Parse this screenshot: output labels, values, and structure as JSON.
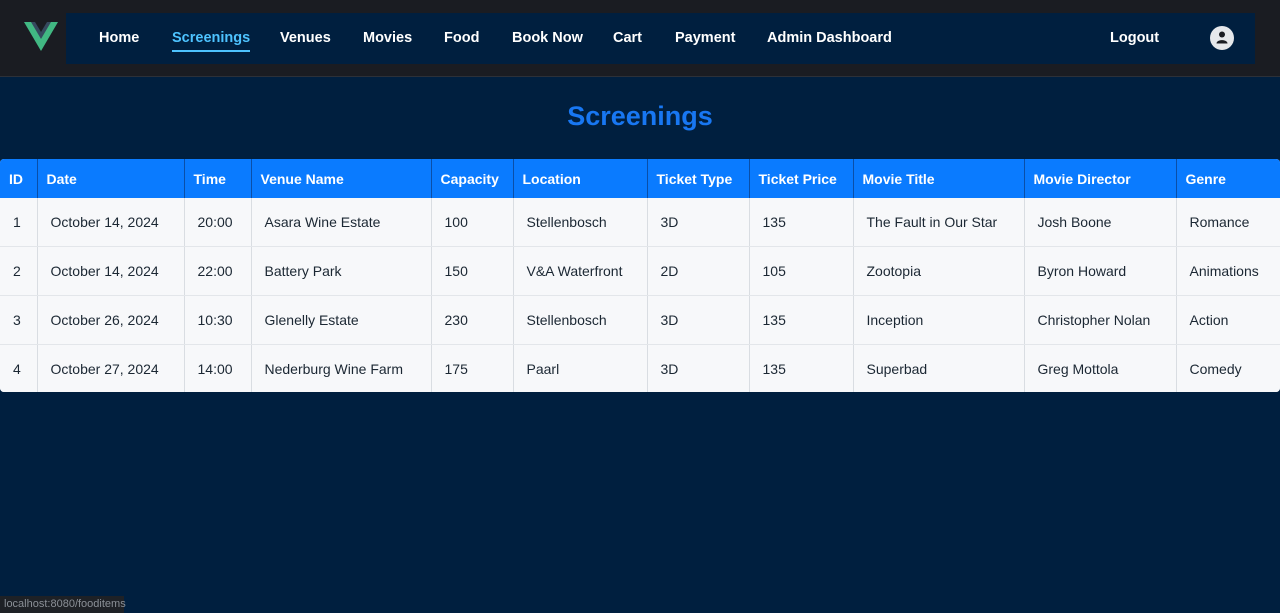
{
  "nav": {
    "logo_icon": "vue-logo-icon",
    "links": [
      {
        "label": "Home",
        "active": false
      },
      {
        "label": "Screenings",
        "active": true
      },
      {
        "label": "Venues",
        "active": false
      },
      {
        "label": "Movies",
        "active": false
      },
      {
        "label": "Food",
        "active": false
      },
      {
        "label": "Book Now",
        "active": false
      },
      {
        "label": "Cart",
        "active": false
      },
      {
        "label": "Payment",
        "active": false
      },
      {
        "label": "Admin Dashboard",
        "active": false
      }
    ],
    "logout_label": "Logout",
    "avatar_icon": "user-icon"
  },
  "page": {
    "title": "Screenings"
  },
  "table": {
    "columns": [
      "ID",
      "Date",
      "Time",
      "Venue Name",
      "Capacity",
      "Location",
      "Ticket Type",
      "Ticket Price",
      "Movie Title",
      "Movie Director",
      "Genre"
    ],
    "rows": [
      [
        "1",
        "October 14, 2024",
        "20:00",
        "Asara Wine Estate",
        "100",
        "Stellenbosch",
        "3D",
        "135",
        "The Fault in Our Star",
        "Josh Boone",
        "Romance"
      ],
      [
        "2",
        "October 14, 2024",
        "22:00",
        "Battery Park",
        "150",
        "V&A Waterfront",
        "2D",
        "105",
        "Zootopia",
        "Byron Howard",
        "Animations"
      ],
      [
        "3",
        "October 26, 2024",
        "10:30",
        "Glenelly Estate",
        "230",
        "Stellenbosch",
        "3D",
        "135",
        "Inception",
        "Christopher Nolan",
        "Action"
      ],
      [
        "4",
        "October 27, 2024",
        "14:00",
        "Nederburg Wine Farm",
        "175",
        "Paarl",
        "3D",
        "135",
        "Superbad",
        "Greg Mottola",
        "Comedy"
      ]
    ]
  },
  "status_bar": {
    "url": "localhost:8080/fooditems"
  },
  "colors": {
    "background": "#001f3f",
    "header": "#0a7bff",
    "title": "#1877f2",
    "active_link": "#4dc3ff"
  }
}
